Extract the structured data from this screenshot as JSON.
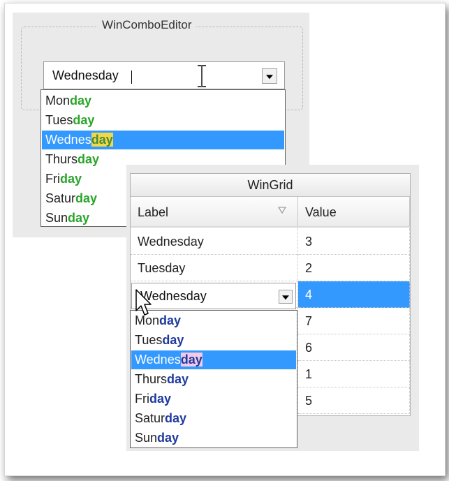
{
  "combo_editor": {
    "title": "WinComboEditor",
    "value": "Wednesday",
    "items": [
      {
        "prefix": "Mon",
        "suffix": "day"
      },
      {
        "prefix": "Tues",
        "suffix": "day"
      },
      {
        "prefix": "Wednes",
        "suffix": "day"
      },
      {
        "prefix": "Thurs",
        "suffix": "day"
      },
      {
        "prefix": "Fri",
        "suffix": "day"
      },
      {
        "prefix": "Satur",
        "suffix": "day"
      },
      {
        "prefix": "Sun",
        "suffix": "day"
      }
    ],
    "selected_index": 2,
    "highlight_color": "#2aa42a",
    "selected_highlight_bg": "#f0d848"
  },
  "grid": {
    "caption": "WinGrid",
    "columns": [
      "Label",
      "Value"
    ],
    "rows": [
      {
        "label": "Wednesday",
        "value": "3"
      },
      {
        "label": "Tuesday",
        "value": "2"
      },
      {
        "label": "Wednesday",
        "value": "4"
      },
      {
        "label": "",
        "value": "7"
      },
      {
        "label": "",
        "value": "6"
      },
      {
        "label": "",
        "value": "1"
      },
      {
        "label": "",
        "value": "5"
      }
    ],
    "active_row": 2,
    "editor_value": "Wednesday",
    "dropdown_items": [
      {
        "prefix": "Mon",
        "suffix": "day"
      },
      {
        "prefix": "Tues",
        "suffix": "day"
      },
      {
        "prefix": "Wednes",
        "suffix": "day"
      },
      {
        "prefix": "Thurs",
        "suffix": "day"
      },
      {
        "prefix": "Fri",
        "suffix": "day"
      },
      {
        "prefix": "Satur",
        "suffix": "day"
      },
      {
        "prefix": "Sun",
        "suffix": "day"
      }
    ],
    "dropdown_selected_index": 2,
    "highlight_color": "#1f3a9e",
    "selected_highlight_bg": "#f3c9e6"
  },
  "accent_color": "#3399ff"
}
